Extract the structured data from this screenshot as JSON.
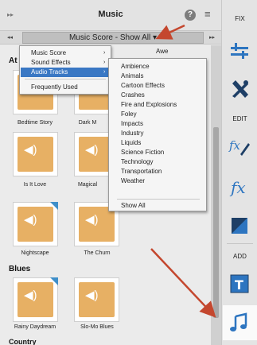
{
  "header": {
    "title": "Music",
    "help_label": "?",
    "menu_label": "≡"
  },
  "filter": {
    "value": "Music Score - Show All",
    "caret": "▾"
  },
  "sections": {
    "s1": "At",
    "s2": "Blues",
    "s3": "Country"
  },
  "tiles": [
    {
      "caption": "Bedtime Story"
    },
    {
      "caption": "Dark M"
    },
    {
      "caption": "Is It Love"
    },
    {
      "caption": "Magical"
    },
    {
      "caption": "Nightscape"
    },
    {
      "caption": "The Churn"
    },
    {
      "caption": "Rainy Daydream"
    },
    {
      "caption": "Slo-Mo Blues"
    }
  ],
  "category_menu": {
    "items": [
      "Music Score",
      "Sound Effects",
      "Audio Tracks"
    ],
    "frequent": "Frequently Used",
    "partial_caption": "Awe"
  },
  "submenu": {
    "items": [
      "Ambience",
      "Animals",
      "Cartoon Effects",
      "Crashes",
      "Fire and Explosions",
      "Foley",
      "Impacts",
      "Industry",
      "Liquids",
      "Science Fiction",
      "Technology",
      "Transportation",
      "Weather"
    ],
    "show_all": "Show All"
  },
  "toolbar": {
    "fix": "FIX",
    "edit": "EDIT",
    "add": "ADD"
  },
  "colors": {
    "selection": "#3a78c4",
    "tile": "#e7b064",
    "icon_blue": "#2d75c0",
    "arrow": "#c4472e"
  }
}
